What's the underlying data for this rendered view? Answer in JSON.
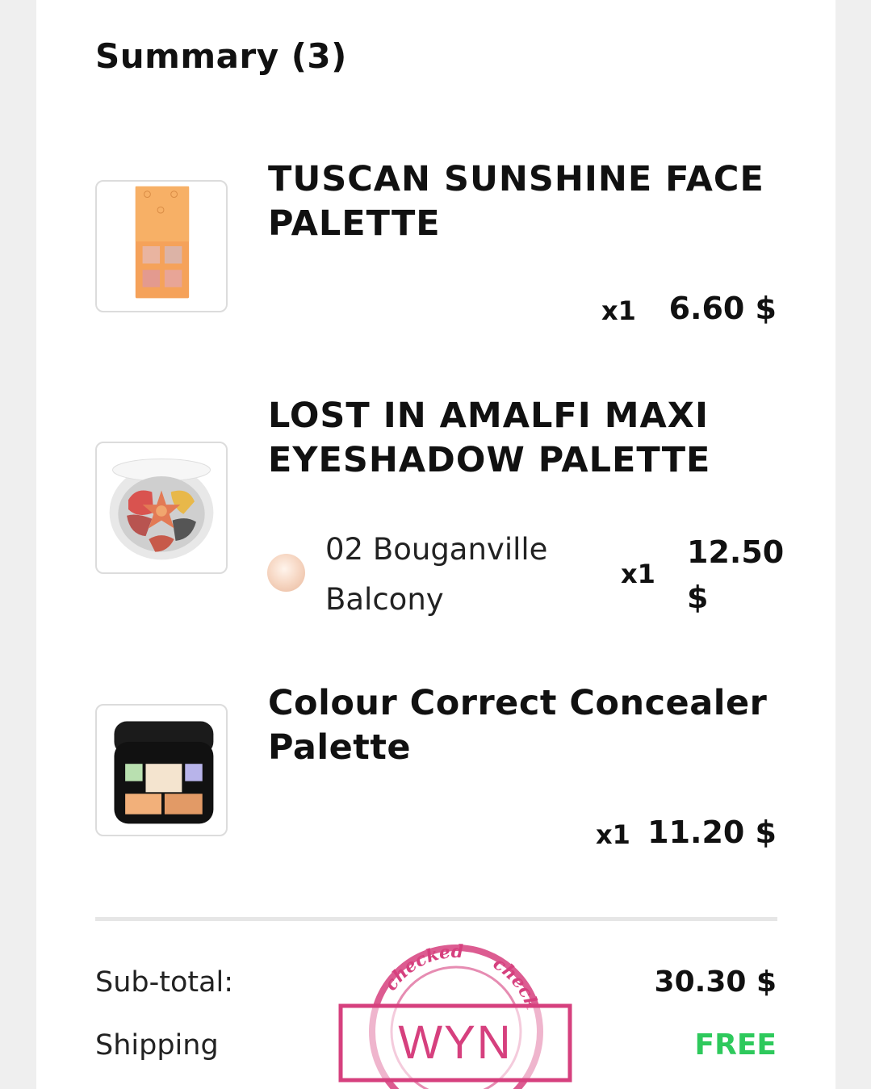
{
  "summary": {
    "title": "Summary (3)"
  },
  "items": [
    {
      "name": "TUSCAN SUNSHINE FACE PALETTE",
      "quantity": "x1",
      "price": "6.60 $"
    },
    {
      "name": "LOST IN AMALFI MAXI EYESHADOW PALETTE",
      "variant": "02 Bouganville Balcony",
      "quantity": "x1",
      "price": "12.50 $"
    },
    {
      "name": "Colour Correct Concealer Palette",
      "quantity": "x1",
      "price": "11.20 $"
    }
  ],
  "totals": {
    "subtotal_label": "Sub-total:",
    "subtotal_value": "30.30 $",
    "shipping_label": "Shipping",
    "shipping_value": "FREE"
  },
  "stamp": {
    "text": "WYN",
    "ring_text_1": "checked",
    "ring_text_2": "check"
  },
  "colors": {
    "free": "#2ec95c",
    "stamp": "#d6407e",
    "background": "#efefef"
  }
}
